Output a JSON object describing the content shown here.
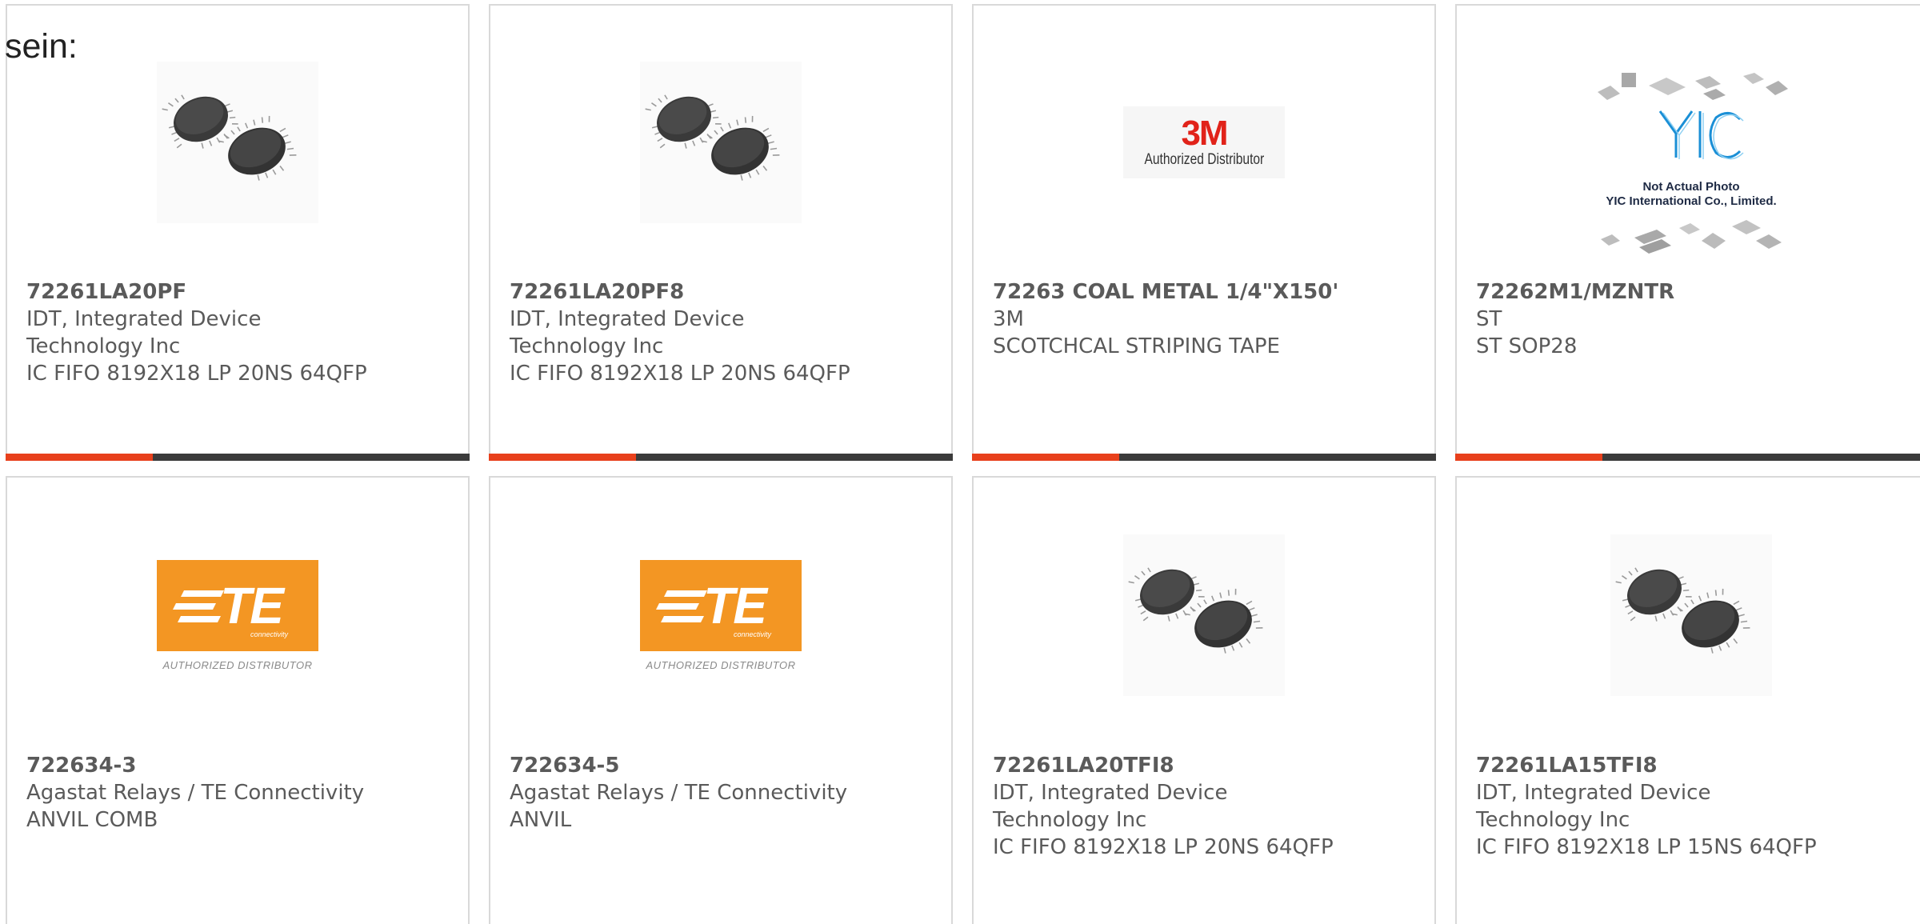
{
  "lead_text": "sein:",
  "colors": {
    "accent": "#e8401c",
    "bar": "#3b3b3b",
    "text": "#5a5a5a",
    "border": "#d9d9d9"
  },
  "products": [
    {
      "part_number": "72261LA20PF",
      "manufacturer": "IDT, Integrated Device Technology Inc",
      "description": "IC FIFO 8192X18 LP 20NS 64QFP",
      "image": "qfp-chip-photo"
    },
    {
      "part_number": "72261LA20PF8",
      "manufacturer": "IDT, Integrated Device Technology Inc",
      "description": "IC FIFO 8192X18 LP 20NS 64QFP",
      "image": "qfp-chip-photo"
    },
    {
      "part_number": "72263 COAL METAL 1/4\"X150'",
      "manufacturer": "3M",
      "description": "SCOTCHCAL STRIPING TAPE",
      "image": "3m-logo",
      "logo_text": "3M",
      "logo_caption": "Authorized Distributor"
    },
    {
      "part_number": "72262M1/MZNTR",
      "manufacturer": "ST",
      "description": "ST SOP28",
      "image": "yic-placeholder",
      "logo_caption_1": "Not Actual Photo",
      "logo_caption_2": "YIC International Co., Limited."
    },
    {
      "part_number": "722634-3",
      "manufacturer": "Agastat Relays / TE Connectivity",
      "description": "ANVIL COMB",
      "image": "te-logo",
      "logo_text": "TE",
      "logo_sub": "connectivity",
      "logo_caption": "AUTHORIZED DISTRIBUTOR"
    },
    {
      "part_number": "722634-5",
      "manufacturer": "Agastat Relays / TE Connectivity",
      "description": "ANVIL",
      "image": "te-logo",
      "logo_text": "TE",
      "logo_sub": "connectivity",
      "logo_caption": "AUTHORIZED DISTRIBUTOR"
    },
    {
      "part_number": "72261LA20TFI8",
      "manufacturer": "IDT, Integrated Device Technology Inc",
      "description": "IC FIFO 8192X18 LP 20NS 64QFP",
      "image": "qfp-chip-photo"
    },
    {
      "part_number": "72261LA15TFI8",
      "manufacturer": "IDT, Integrated Device Technology Inc",
      "description": "IC FIFO 8192X18 LP 15NS 64QFP",
      "image": "qfp-chip-photo"
    }
  ]
}
